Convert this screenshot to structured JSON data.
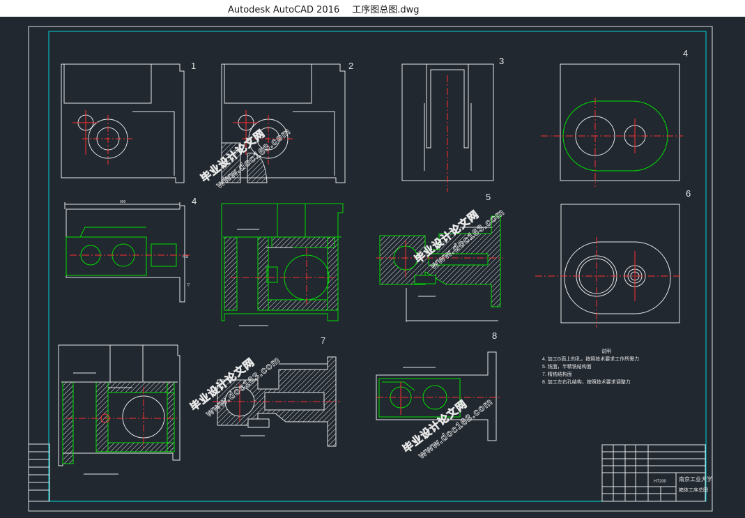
{
  "window": {
    "app_name": "Autodesk AutoCAD 2016",
    "file_name": "工序图总图.dwg"
  },
  "colors": {
    "background": "#212830",
    "frame_outer": "#e0e0e0",
    "frame_inner": "#00d8d8",
    "part_outline": "#e8e8e8",
    "section_outline": "#00e000",
    "centerline": "#ff3030",
    "watermark": "#e8e8e8"
  },
  "views": [
    {
      "label": "1"
    },
    {
      "label": "2"
    },
    {
      "label": "3"
    },
    {
      "label": "4"
    },
    {
      "label": "4"
    },
    {
      "label": "5"
    },
    {
      "label": "6"
    },
    {
      "label": "7"
    },
    {
      "label": "8"
    }
  ],
  "notes": {
    "heading": "说明",
    "lines": [
      "4. 加工G面上的孔，按照技术要求工作所需力",
      "5. 铣面，半精铣结构面",
      "7. 精铣结构面",
      "8. 加工左右孔结构，按照技术要求调整力"
    ]
  },
  "title_block": {
    "school": "南京工业大学",
    "drawing_name": "箱体工序总图",
    "material": "HT200"
  },
  "watermarks": [
    {
      "text": "毕业设计论文网"
    },
    {
      "text": "www.doc163.com"
    }
  ]
}
